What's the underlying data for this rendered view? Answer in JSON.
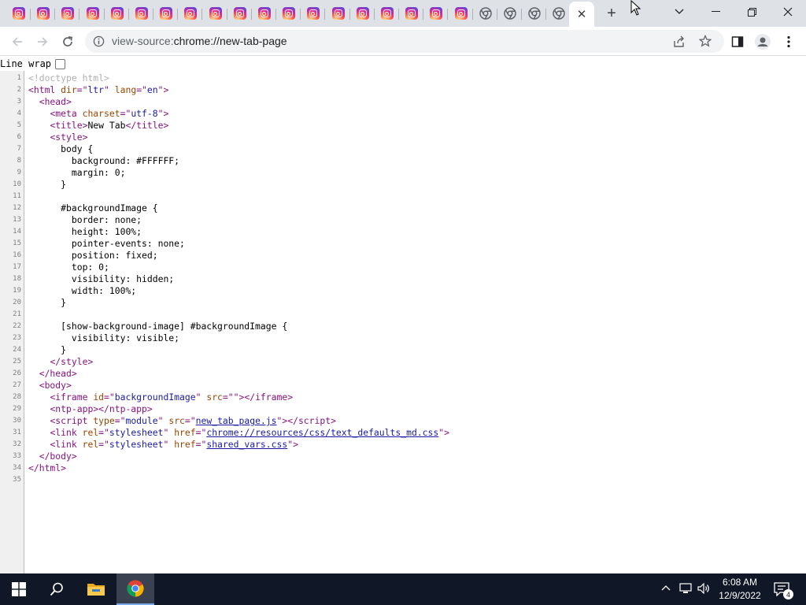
{
  "tabs": {
    "instagram_count": 19,
    "chrome_count": 4,
    "new_tab_symbol": "+"
  },
  "toolbar": {
    "url_scheme": "view-source:",
    "url_rest": "chrome://new-tab-page"
  },
  "view_source": {
    "line_wrap_label": "Line wrap",
    "lines": [
      {
        "n": "1",
        "html": "<span class=\"cm\">&lt;!doctype html&gt;</span>"
      },
      {
        "n": "2",
        "html": "<span class=\"t\">&lt;html</span> <span class=\"a\">dir</span><span class=\"t\">=\"</span><span class=\"v\">ltr</span><span class=\"t\">\"</span> <span class=\"a\">lang</span><span class=\"t\">=\"</span><span class=\"v\">en</span><span class=\"t\">\"&gt;</span>"
      },
      {
        "n": "3",
        "html": "  <span class=\"t\">&lt;head&gt;</span>"
      },
      {
        "n": "4",
        "html": "    <span class=\"t\">&lt;meta</span> <span class=\"a\">charset</span><span class=\"t\">=\"</span><span class=\"v\">utf-8</span><span class=\"t\">\"&gt;</span>"
      },
      {
        "n": "5",
        "html": "    <span class=\"t\">&lt;title&gt;</span>New Tab<span class=\"t\">&lt;/title&gt;</span>"
      },
      {
        "n": "6",
        "html": "    <span class=\"t\">&lt;style&gt;</span>"
      },
      {
        "n": "7",
        "html": "      body {"
      },
      {
        "n": "8",
        "html": "        background: #FFFFFF;"
      },
      {
        "n": "9",
        "html": "        margin: 0;"
      },
      {
        "n": "10",
        "html": "      }"
      },
      {
        "n": "11",
        "html": ""
      },
      {
        "n": "12",
        "html": "      #backgroundImage {"
      },
      {
        "n": "13",
        "html": "        border: none;"
      },
      {
        "n": "14",
        "html": "        height: 100%;"
      },
      {
        "n": "15",
        "html": "        pointer-events: none;"
      },
      {
        "n": "16",
        "html": "        position: fixed;"
      },
      {
        "n": "17",
        "html": "        top: 0;"
      },
      {
        "n": "18",
        "html": "        visibility: hidden;"
      },
      {
        "n": "19",
        "html": "        width: 100%;"
      },
      {
        "n": "20",
        "html": "      }"
      },
      {
        "n": "21",
        "html": ""
      },
      {
        "n": "22",
        "html": "      [show-background-image] #backgroundImage {"
      },
      {
        "n": "23",
        "html": "        visibility: visible;"
      },
      {
        "n": "24",
        "html": "      }"
      },
      {
        "n": "25",
        "html": "    <span class=\"t\">&lt;/style&gt;</span>"
      },
      {
        "n": "26",
        "html": "  <span class=\"t\">&lt;/head&gt;</span>"
      },
      {
        "n": "27",
        "html": "  <span class=\"t\">&lt;body&gt;</span>"
      },
      {
        "n": "28",
        "html": "    <span class=\"t\">&lt;iframe</span> <span class=\"a\">id</span><span class=\"t\">=\"</span><span class=\"v\">backgroundImage</span><span class=\"t\">\"</span> <span class=\"a\">src</span><span class=\"t\">=\"\"&gt;&lt;/iframe&gt;</span>"
      },
      {
        "n": "29",
        "html": "    <span class=\"t\">&lt;ntp-app&gt;&lt;/ntp-app&gt;</span>"
      },
      {
        "n": "30",
        "html": "    <span class=\"t\">&lt;script</span> <span class=\"a\">type</span><span class=\"t\">=\"</span><span class=\"v\">module</span><span class=\"t\">\"</span> <span class=\"a\">src</span><span class=\"t\">=\"</span><span class=\"lk\">new_tab_page.js</span><span class=\"t\">\"&gt;&lt;/script&gt;</span>"
      },
      {
        "n": "31",
        "html": "    <span class=\"t\">&lt;link</span> <span class=\"a\">rel</span><span class=\"t\">=\"</span><span class=\"v\">stylesheet</span><span class=\"t\">\"</span> <span class=\"a\">href</span><span class=\"t\">=\"</span><span class=\"lk\">chrome://resources/css/text_defaults_md.css</span><span class=\"t\">\"&gt;</span>"
      },
      {
        "n": "32",
        "html": "    <span class=\"t\">&lt;link</span> <span class=\"a\">rel</span><span class=\"t\">=\"</span><span class=\"v\">stylesheet</span><span class=\"t\">\"</span> <span class=\"a\">href</span><span class=\"t\">=\"</span><span class=\"lk\">shared_vars.css</span><span class=\"t\">\"&gt;</span>"
      },
      {
        "n": "33",
        "html": "  <span class=\"t\">&lt;/body&gt;</span>"
      },
      {
        "n": "34",
        "html": "<span class=\"t\">&lt;/html&gt;</span>"
      },
      {
        "n": "35",
        "html": ""
      }
    ]
  },
  "taskbar": {
    "time": "6:08 AM",
    "date": "12/9/2022",
    "notification_count": "4"
  }
}
